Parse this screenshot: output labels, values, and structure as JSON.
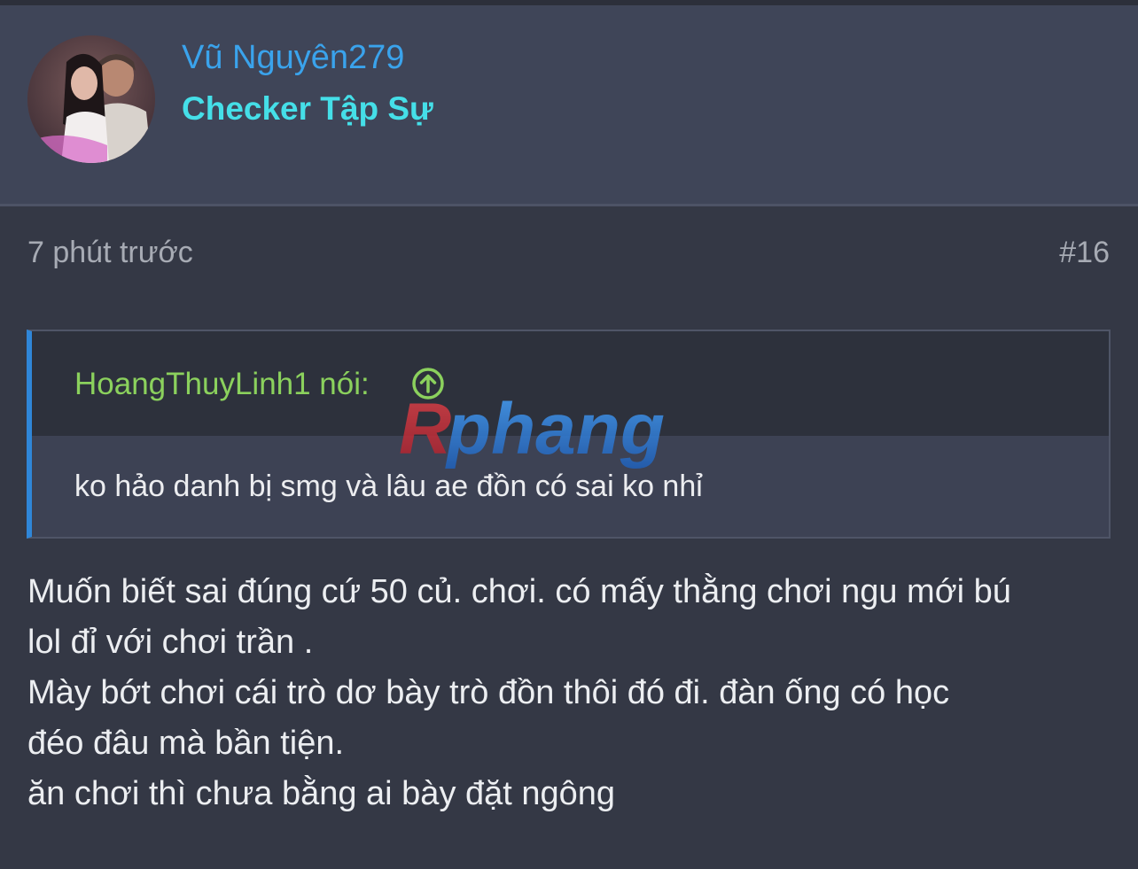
{
  "user": {
    "name": "Vũ Nguyên279",
    "title": "Checker Tập Sự"
  },
  "post": {
    "time": "7 phút trước",
    "number": "#16",
    "quote": {
      "author": "HoangThuyLinh1 nói:",
      "text": "ko hảo danh bị smg và lâu ae đồn có sai ko nhỉ"
    },
    "content_lines": [
      "Muốn biết sai đúng cứ 50 củ. chơi. có mấy thằng chơi ngu mới bú",
      "lol đỉ với chơi trần .",
      "Mày bớt chơi cái trò dơ bày trò đồn thôi đó đi. đàn ống có học",
      "đéo đâu mà bần tiện.",
      "ăn chơi thì chưa bằng ai bày đặt ngông"
    ]
  },
  "watermark": {
    "text": "Rphang"
  },
  "colors": {
    "background": "#343845",
    "header": "#3f4558",
    "username": "#3aa3ec",
    "user_title": "#45dfe8",
    "quote_author": "#8bd15d",
    "quote_border": "#2f86d8",
    "meta_text": "#a7abb4"
  },
  "icons": {
    "avatar": "user-avatar-photo",
    "quote_jump": "arrow-up-circle-icon"
  }
}
